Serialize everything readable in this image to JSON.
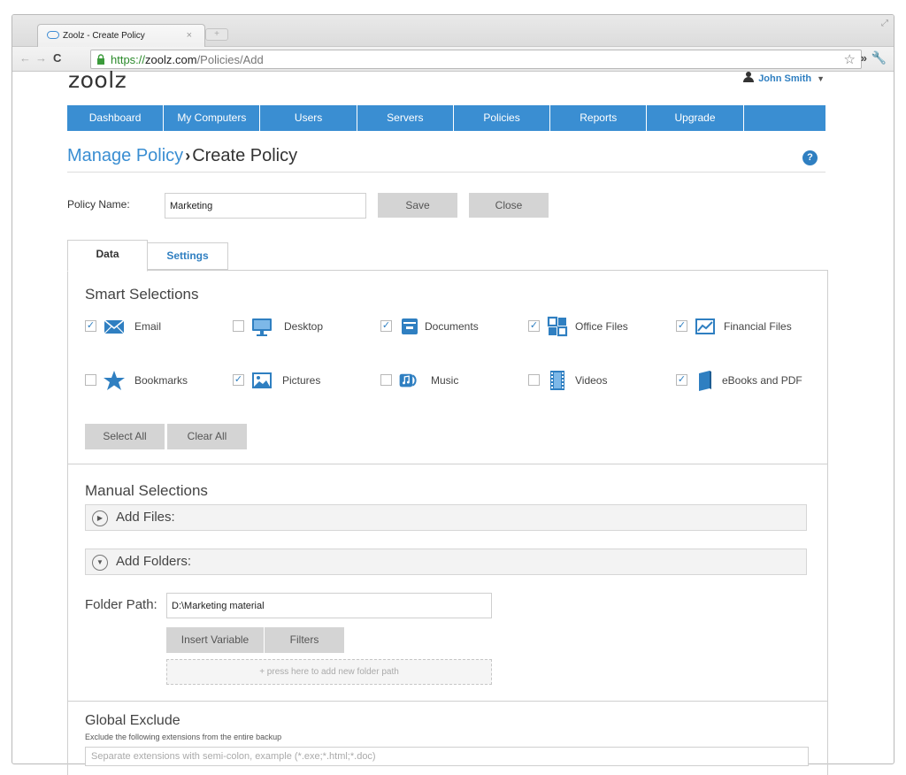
{
  "browser": {
    "tab_title": "Zoolz - Create Policy",
    "tab_close": "×",
    "new_tab": "+",
    "url_scheme": "https://",
    "url_host": "zoolz.com",
    "url_path": "/Policies/Add"
  },
  "header": {
    "logo": "zoolz",
    "user_name": "John Smith",
    "user_caret": "▼"
  },
  "nav": [
    "Dashboard",
    "My Computers",
    "Users",
    "Servers",
    "Policies",
    "Reports",
    "Upgrade",
    ""
  ],
  "breadcrumb": {
    "parent": "Manage Policy",
    "separator": "›",
    "current": "Create Policy",
    "help": "?"
  },
  "policy": {
    "name_label": "Policy Name:",
    "name_value": "Marketing",
    "save_label": "Save",
    "close_label": "Close"
  },
  "tabs": {
    "data": "Data",
    "settings": "Settings"
  },
  "smart": {
    "title": "Smart Selections",
    "items": [
      {
        "label": "Email",
        "checked": "✓",
        "icon": "email-icon"
      },
      {
        "label": "Desktop",
        "checked": "",
        "icon": "desktop-icon"
      },
      {
        "label": "Documents",
        "checked": "✓",
        "icon": "documents-icon"
      },
      {
        "label": "Office Files",
        "checked": "✓",
        "icon": "office-files-icon"
      },
      {
        "label": "Financial Files",
        "checked": "✓",
        "icon": "financial-icon"
      },
      {
        "label": "Bookmarks",
        "checked": "",
        "icon": "bookmarks-icon"
      },
      {
        "label": "Pictures",
        "checked": "✓",
        "icon": "pictures-icon"
      },
      {
        "label": "Music",
        "checked": "",
        "icon": "music-icon"
      },
      {
        "label": "Videos",
        "checked": "",
        "icon": "videos-icon"
      },
      {
        "label": "eBooks and PDF",
        "checked": "✓",
        "icon": "ebook-icon"
      }
    ],
    "select_all": "Select All",
    "clear_all": "Clear All"
  },
  "manual": {
    "title": "Manual Selections",
    "add_files": "Add Files:",
    "add_folders": "Add Folders:",
    "folder_path_label": "Folder Path:",
    "folder_path_value": "D:\\Marketing material",
    "insert_variable": "Insert Variable",
    "filters": "Filters",
    "add_path_hint": "+ press here to add new folder path"
  },
  "global": {
    "title": "Global Exclude",
    "subtitle": "Exclude the following extensions from the entire backup",
    "placeholder": "Separate extensions with semi-colon, example (*.exe;*.html;*.doc)"
  },
  "colors": {
    "accent": "#3a8ed2",
    "button_grey": "#d4d4d4"
  }
}
